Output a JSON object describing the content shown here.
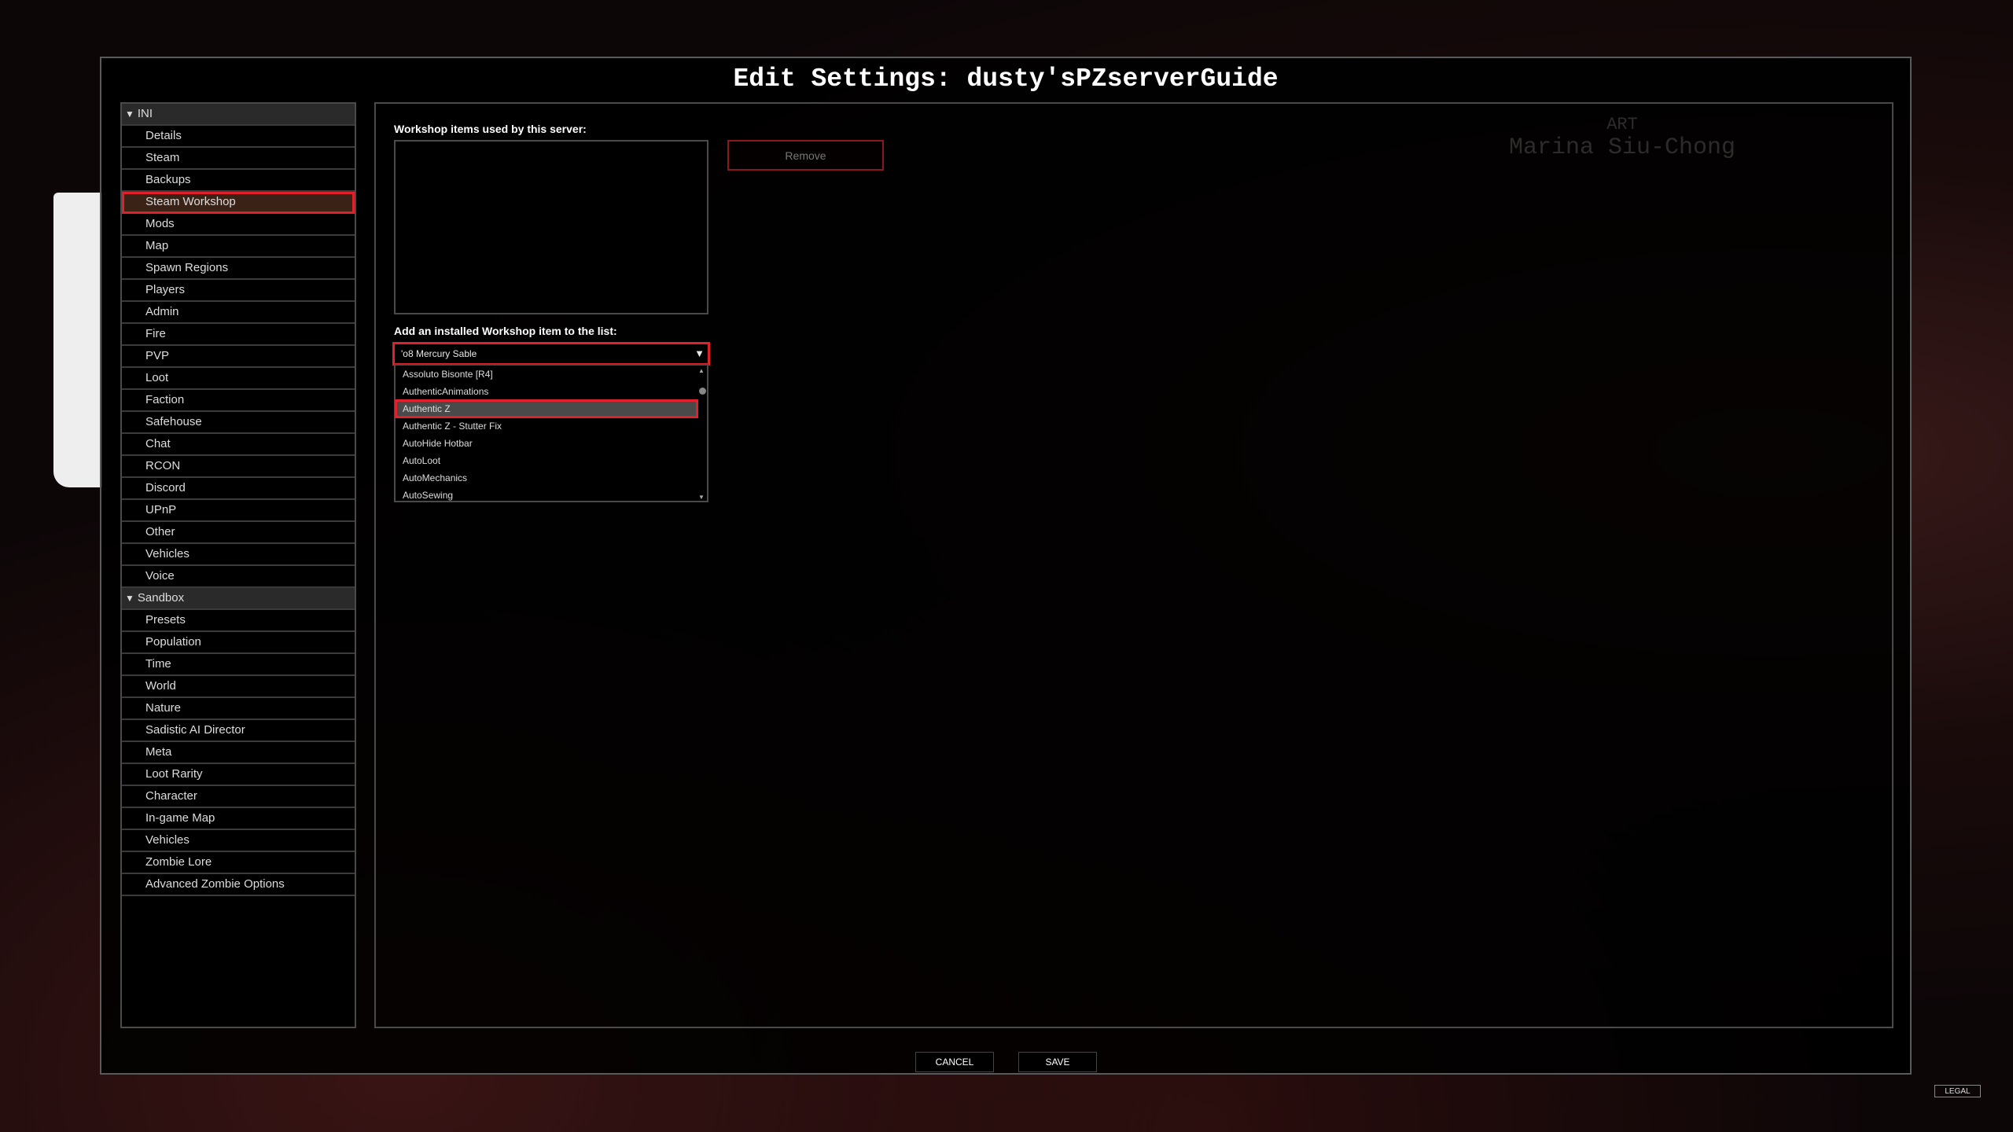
{
  "window": {
    "title": "Edit Settings: dusty'sPZserverGuide"
  },
  "background_credit": {
    "label": "ART",
    "name": "Marina Siu-Chong"
  },
  "sidebar": {
    "groups": [
      {
        "label": "INI",
        "items": [
          "Details",
          "Steam",
          "Backups",
          "Steam Workshop",
          "Mods",
          "Map",
          "Spawn Regions",
          "Players",
          "Admin",
          "Fire",
          "PVP",
          "Loot",
          "Faction",
          "Safehouse",
          "Chat",
          "RCON",
          "Discord",
          "UPnP",
          "Other",
          "Vehicles",
          "Voice"
        ]
      },
      {
        "label": "Sandbox",
        "items": [
          "Presets",
          "Population",
          "Time",
          "World",
          "Nature",
          "Sadistic AI Director",
          "Meta",
          "Loot Rarity",
          "Character",
          "In-game Map",
          "Vehicles",
          "Zombie Lore",
          "Advanced Zombie Options"
        ]
      }
    ],
    "selected": "Steam Workshop"
  },
  "main": {
    "workshop_label": "Workshop items used by this server:",
    "remove_label": "Remove",
    "add_label": "Add an installed Workshop item to the list:",
    "combo_value": "'o8 Mercury Sable",
    "dropdown_options": [
      "Assoluto Bisonte [R4]",
      "AuthenticAnimations",
      "Authentic Z",
      "Authentic Z - Stutter Fix",
      "AutoHide Hotbar",
      "AutoLoot",
      "AutoMechanics",
      "AutoSewing"
    ],
    "highlighted_option": "Authentic Z"
  },
  "footer": {
    "cancel": "CANCEL",
    "save": "SAVE",
    "legal": "LEGAL"
  },
  "colors": {
    "accent_highlight": "#e0202a"
  }
}
